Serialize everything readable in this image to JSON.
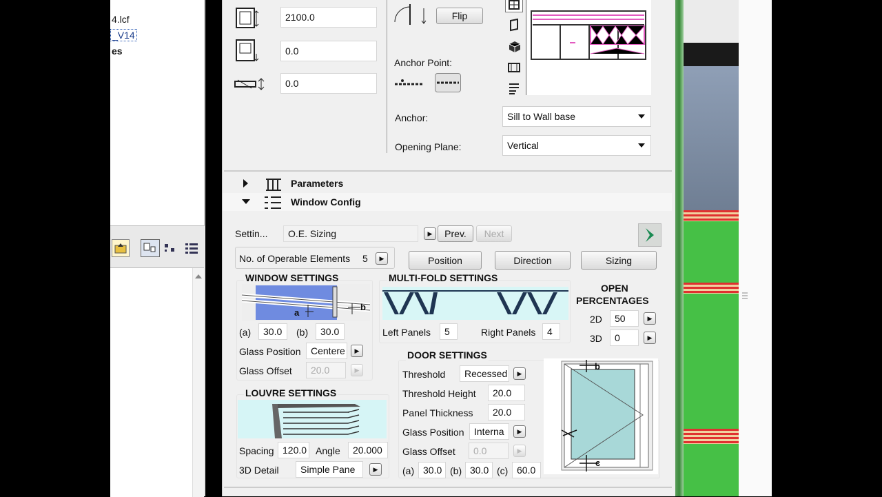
{
  "left_panel": {
    "files": [
      "4.lcf",
      "_V14",
      "es"
    ]
  },
  "top": {
    "height_value": "2100.0",
    "sill_value": "0.0",
    "offset_value": "0.0",
    "flip_label": "Flip",
    "anchor_point_label": "Anchor Point:",
    "anchor_label": "Anchor:",
    "anchor_value": "Sill to Wall base",
    "opening_plane_label": "Opening Plane:",
    "opening_plane_value": "Vertical"
  },
  "sections": {
    "parameters": "Parameters",
    "window_config": "Window Config"
  },
  "config": {
    "settings_label": "Settin...",
    "settings_value": "O.E. Sizing",
    "prev_label": "Prev.",
    "next_label": "Next",
    "operable_label": "No. of Operable Elements",
    "operable_value": "5",
    "position_btn": "Position",
    "direction_btn": "Direction",
    "sizing_btn": "Sizing"
  },
  "window_settings": {
    "title": "WINDOW SETTINGS",
    "a_label": "(a)",
    "a_value": "30.0",
    "b_label": "(b)",
    "b_value": "30.0",
    "glass_position_label": "Glass Position",
    "glass_position_value": "Centere",
    "glass_offset_label": "Glass Offset",
    "glass_offset_value": "20.0",
    "diagram_a": "a",
    "diagram_b": "b"
  },
  "multifold": {
    "title": "MULTI-FOLD SETTINGS",
    "left_label": "Left Panels",
    "left_value": "5",
    "right_label": "Right Panels",
    "right_value": "4"
  },
  "open_pct": {
    "title_1": "OPEN",
    "title_2": "PERCENTAGES",
    "d2_label": "2D",
    "d2_value": "50",
    "d3_label": "3D",
    "d3_value": "0"
  },
  "louvre": {
    "title": "LOUVRE SETTINGS",
    "spacing_label": "Spacing",
    "spacing_value": "120.0",
    "angle_label": "Angle",
    "angle_value": "20.000",
    "detail_label": "3D Detail",
    "detail_value": "Simple Pane"
  },
  "door": {
    "title": "DOOR SETTINGS",
    "threshold_label": "Threshold",
    "threshold_value": "Recessed",
    "threshold_height_label": "Threshold Height",
    "threshold_height_value": "20.0",
    "panel_thickness_label": "Panel Thickness",
    "panel_thickness_value": "20.0",
    "glass_position_label": "Glass Position",
    "glass_position_value": "Interna",
    "glass_offset_label": "Glass Offset",
    "glass_offset_value": "0.0",
    "a_label": "(a)",
    "a_value": "30.0",
    "b_label": "(b)",
    "b_value": "30.0",
    "c_label": "(c)",
    "c_value": "60.0",
    "diagram_b": "b",
    "diagram_c": "c"
  }
}
